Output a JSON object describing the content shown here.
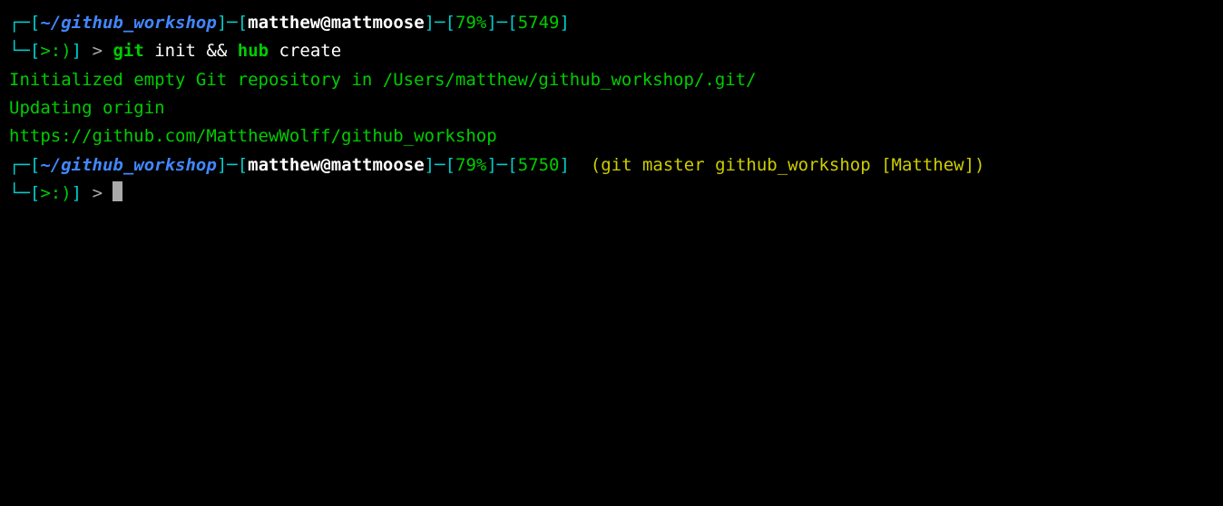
{
  "prompt1": {
    "corner_tl": "┌─",
    "br1": "[",
    "dir": "~/github_workshop",
    "br2": "]",
    "dash1": "─",
    "br3": "[",
    "user": "matthew",
    "at": "@",
    "host": "mattmoose",
    "br4": "]",
    "dash2": "─",
    "br5": "[",
    "percent": "79%",
    "br6": "]",
    "dash3": "─",
    "br7": "[",
    "histnum": "5749",
    "br8": "]",
    "corner_bl": "└─",
    "face_br1": "[",
    "face": ">:)",
    "face_br2": "]",
    "arrow": " > "
  },
  "command1": {
    "cmd1": "git",
    "arg1": " init ",
    "op": "&&",
    "cmd2": " hub",
    "arg2": " create"
  },
  "output": {
    "line1": "Initialized empty Git repository in /Users/matthew/github_workshop/.git/",
    "line2": "Updating origin",
    "line3": "https://github.com/MatthewWolff/github_workshop"
  },
  "prompt2": {
    "corner_tl": "┌─",
    "br1": "[",
    "dir": "~/github_workshop",
    "br2": "]",
    "dash1": "─",
    "br3": "[",
    "user": "matthew",
    "at": "@",
    "host": "mattmoose",
    "br4": "]",
    "dash2": "─",
    "br5": "[",
    "percent": "79%",
    "br6": "]",
    "dash3": "─",
    "br7": "[",
    "histnum": "5750",
    "br8": "]",
    "gitinfo": "  (git master github_workshop [Matthew])",
    "corner_bl": "└─",
    "face_br1": "[",
    "face": ">:)",
    "face_br2": "]",
    "arrow": " > "
  }
}
